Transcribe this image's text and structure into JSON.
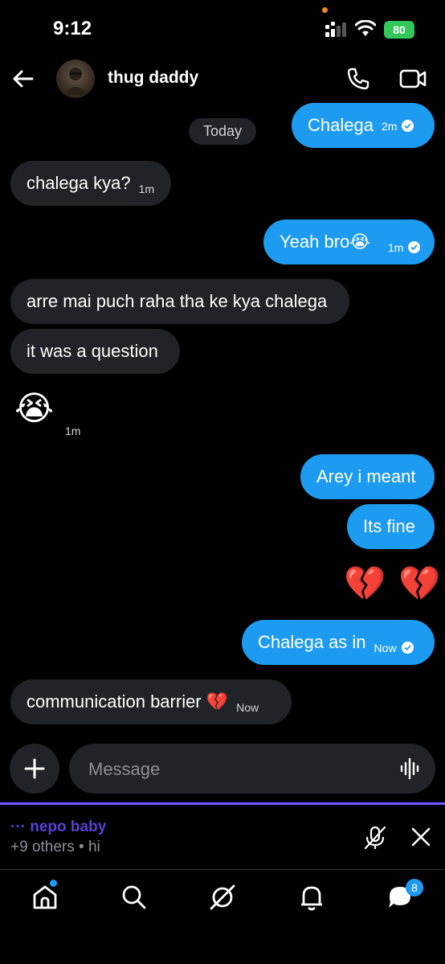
{
  "status_bar": {
    "time": "9:12",
    "battery": "80"
  },
  "header": {
    "title": "thug daddy"
  },
  "conversation": {
    "date_divider": "Today",
    "messages": [
      {
        "side": "out",
        "text": "Chalega",
        "time": "2m",
        "read": true
      },
      {
        "side": "in",
        "text": "chalega kya?",
        "time": "1m"
      },
      {
        "side": "out",
        "text": "Yeah bro😭",
        "time": "1m",
        "read": true
      },
      {
        "side": "in",
        "text": "arre mai puch raha tha ke kya chalega"
      },
      {
        "side": "in",
        "text": "it was a question"
      },
      {
        "side": "in",
        "text": "😭",
        "time": "1m",
        "big_emoji": true
      },
      {
        "side": "out",
        "text": "Arey i meant"
      },
      {
        "side": "out",
        "text": "Its fine"
      },
      {
        "side": "out",
        "text": "💔 💔",
        "big_emoji": true
      },
      {
        "side": "out",
        "text": "Chalega as in",
        "time": "Now",
        "read": true
      },
      {
        "side": "in",
        "text": "communication barrier 💔",
        "time": "Now"
      }
    ]
  },
  "composer": {
    "placeholder": "Message"
  },
  "audio_space": {
    "name": "··· nepo baby",
    "subtitle": "+9 others • hi"
  },
  "bottom_nav": {
    "messages_badge": "8"
  },
  "colors": {
    "accent": "#1d9bf0",
    "space_purple": "#7856ff",
    "bubble_in": "#202327"
  }
}
